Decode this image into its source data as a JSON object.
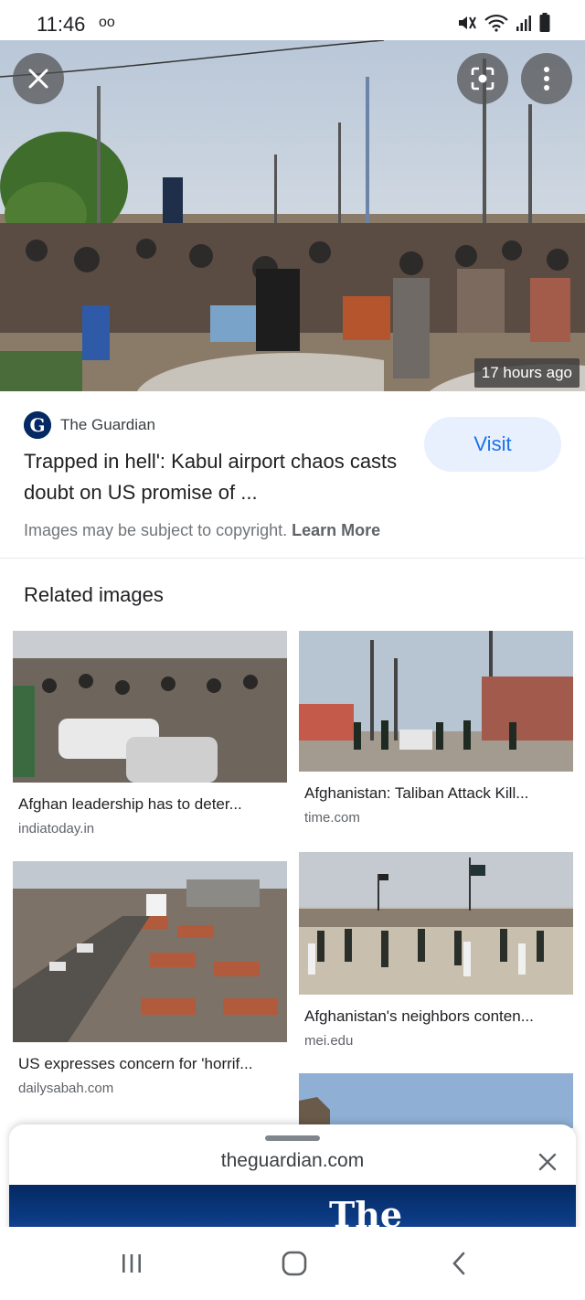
{
  "status_bar": {
    "time": "11:46",
    "voicemail": "oo"
  },
  "hero": {
    "timestamp": "17 hours ago"
  },
  "source": {
    "name": "The Guardian",
    "logo_letter": "G"
  },
  "article": {
    "title": "Trapped in hell': Kabul airport chaos casts doubt on US promise of ...",
    "visit_label": "Visit"
  },
  "copyright": {
    "text": "Images may be subject to copyright. ",
    "learn_more": "Learn More"
  },
  "related": {
    "heading": "Related images",
    "items": [
      {
        "title": "Afghan leadership has to deter...",
        "domain": "indiatoday.in"
      },
      {
        "title": "Afghanistan: Taliban Attack Kill...",
        "domain": "time.com"
      },
      {
        "title": "US expresses concern for 'horrif...",
        "domain": "dailysabah.com"
      },
      {
        "title": "Afghanistan's neighbors conten...",
        "domain": "mei.edu"
      }
    ]
  },
  "sheet": {
    "domain": "theguardian.com",
    "preview_text": "The"
  },
  "colors": {
    "accent": "#1a73e8",
    "visit_bg": "#e8f0fe",
    "guardian_blue": "#052962"
  },
  "icons": [
    "close-icon",
    "lens-icon",
    "more-vert-icon",
    "recents-icon",
    "home-icon",
    "back-icon"
  ]
}
